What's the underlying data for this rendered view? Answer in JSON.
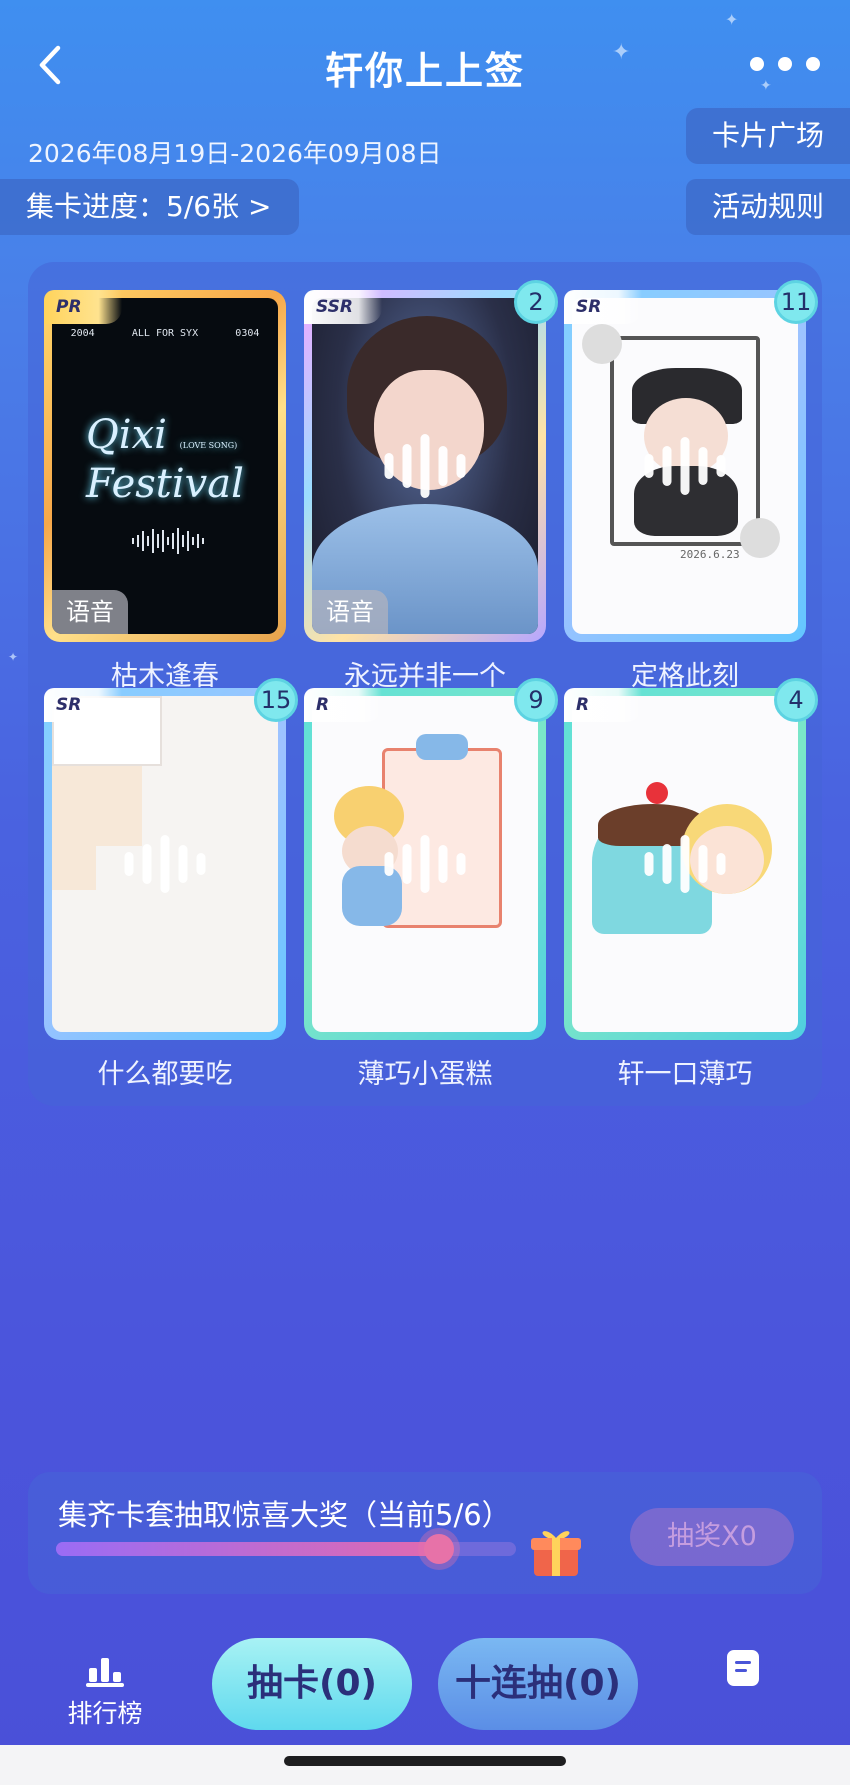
{
  "header": {
    "title": "轩你上上签",
    "date_range": "2026年08月19日-2026年09月08日",
    "card_plaza": "卡片广场",
    "rules": "活动规则",
    "progress": "集卡进度：5/6张 >"
  },
  "cards": [
    {
      "name": "枯木逢春",
      "rarity": "PR",
      "voice": "语音",
      "art": {
        "t1": "2004",
        "t2": "ALL FOR SYX",
        "t3": "0304",
        "logo1": "Qixi",
        "logo_small": "(LOVE SONG)",
        "logo2": "Festival"
      }
    },
    {
      "name": "永远并非一个",
      "rarity": "SSR",
      "count": "2",
      "voice": "语音"
    },
    {
      "name": "定格此刻",
      "rarity": "SR",
      "count": "11",
      "art": {
        "date": "2026.6.23"
      }
    },
    {
      "name": "什么都要吃",
      "rarity": "SR",
      "count": "15"
    },
    {
      "name": "薄巧小蛋糕",
      "rarity": "R",
      "count": "9"
    },
    {
      "name": "轩一口薄巧",
      "rarity": "R",
      "count": "4"
    }
  ],
  "lottery": {
    "label": "集齐卡套抽取惊喜大奖（当前5/6）",
    "progress_fraction": 0.8333,
    "draw_label": "抽奖X0"
  },
  "bottom": {
    "rank_label": "排行榜",
    "draw_one": "抽卡(0)",
    "draw_ten": "十连抽(0)"
  },
  "colors": {
    "accent_cyan": "#7fe8ee",
    "badge_text": "#23306a",
    "panel": "#4a63e0"
  },
  "icons": [
    "back-icon",
    "more-icon",
    "gift-icon",
    "rank-icon",
    "document-icon",
    "voice-wave-icon"
  ]
}
